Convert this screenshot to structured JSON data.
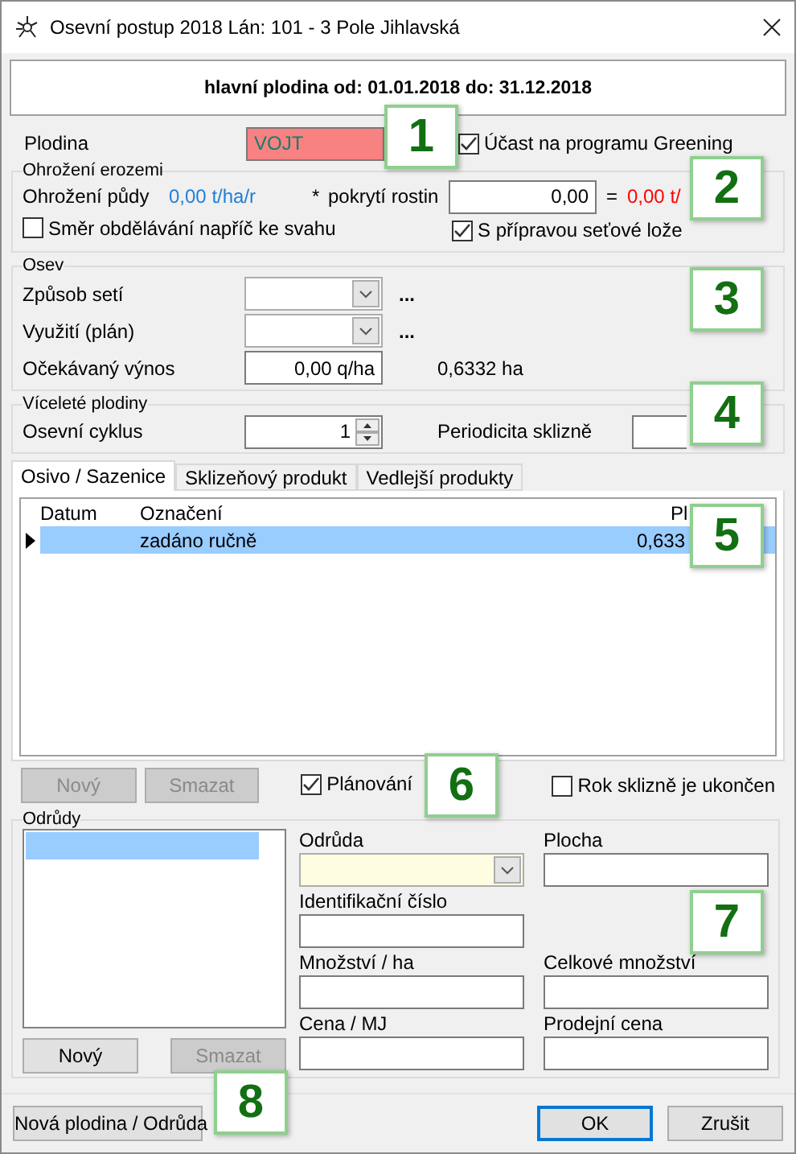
{
  "window": {
    "title": "Osevní postup 2018 Lán: 101 - 3 Pole Jihlavská"
  },
  "header": "hlavní plodina od: 01.01.2018 do: 31.12.2018",
  "plodina": {
    "label": "Plodina",
    "value": "VOJT",
    "invalid": true,
    "greening": {
      "label": "Účast na programu Greening",
      "checked": true
    }
  },
  "eroze": {
    "title": "Ohrožení erozemi",
    "label": "Ohrožení půdy",
    "value": "0,00 t/ha/r",
    "star": "*",
    "cover_label": "pokrytí rostin",
    "cover_value": "0,00",
    "equals": "=",
    "result": "0,00 t/",
    "checks": [
      {
        "label": "Směr obdělávání napříč ke svahu",
        "checked": false
      },
      {
        "label": "S přípravou seťové lože",
        "checked": true
      }
    ]
  },
  "osev": {
    "title": "Osev",
    "rows": [
      {
        "kind": "combo",
        "label": "Způsob setí",
        "more": "..."
      },
      {
        "kind": "combo",
        "label": "Využití (plán)",
        "more": "..."
      },
      {
        "kind": "input",
        "label": "Očekávaný výnos",
        "value": "0,00 q/ha",
        "extra": "0,6332 ha"
      }
    ]
  },
  "viceleta": {
    "title": "Víceleté plodiny",
    "cycle_label": "Osevní cyklus",
    "cycle_value": "1",
    "period_label": "Periodicita sklizně"
  },
  "tabs": [
    {
      "label": "Osivo / Sazenice",
      "selected": true
    },
    {
      "label": "Sklizeňový produkt",
      "selected": false
    },
    {
      "label": "Vedlejší produkty",
      "selected": false
    }
  ],
  "table": {
    "columns": [
      "Datum",
      "Označení",
      "Pl"
    ],
    "rows": [
      {
        "cells": [
          "",
          "zadáno ručně",
          "0,633"
        ],
        "selected": true
      }
    ]
  },
  "seed_buttons": [
    {
      "label": "Nový",
      "disabled": true
    },
    {
      "label": "Smazat",
      "disabled": true
    }
  ],
  "seed_checks": [
    {
      "label": "Plánování",
      "checked": true
    },
    {
      "label": "Rok sklizně je ukončen",
      "checked": false
    }
  ],
  "odrudy": {
    "title": "Odrůdy",
    "list": [
      {
        "selected": true
      }
    ],
    "buttons": [
      {
        "label": "Nový",
        "disabled": false
      },
      {
        "label": "Smazat",
        "disabled": true
      }
    ],
    "fields": [
      {
        "kind": "combo",
        "label": "Odrůda"
      },
      {
        "kind": "input",
        "label": "Plocha"
      },
      {
        "kind": "input",
        "label": "Identifikační číslo"
      },
      {
        "kind": "blank"
      },
      {
        "kind": "input",
        "label": "Množství / ha"
      },
      {
        "kind": "input",
        "label": "Celkové množství"
      },
      {
        "kind": "input",
        "label": "Cena / MJ"
      },
      {
        "kind": "input",
        "label": "Prodejní cena"
      }
    ]
  },
  "footer": {
    "left": "Nová plodina / Odrůda",
    "ok": "OK",
    "cancel": "Zrušit"
  },
  "callouts": [
    "1",
    "2",
    "3",
    "4",
    "5",
    "6",
    "7",
    "8"
  ]
}
